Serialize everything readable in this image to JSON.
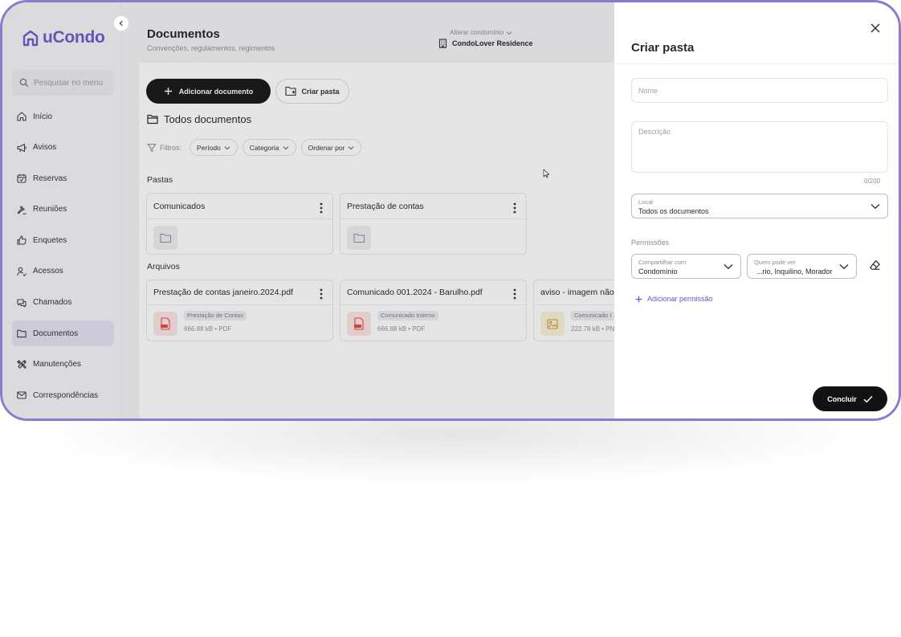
{
  "app": {
    "brand": "uCondo"
  },
  "sidebar": {
    "search_placeholder": "Pesquisar no menu",
    "items": [
      {
        "label": "Início",
        "icon": "home-icon"
      },
      {
        "label": "Avisos",
        "icon": "megaphone-icon"
      },
      {
        "label": "Reservas",
        "icon": "calendar-icon"
      },
      {
        "label": "Reuniões",
        "icon": "gavel-icon"
      },
      {
        "label": "Enquetes",
        "icon": "thumbs-up-icon"
      },
      {
        "label": "Acessos",
        "icon": "user-check-icon"
      },
      {
        "label": "Chamados",
        "icon": "chat-icon"
      },
      {
        "label": "Documentos",
        "icon": "folder-icon",
        "active": true
      },
      {
        "label": "Manutenções",
        "icon": "tools-icon"
      },
      {
        "label": "Correspondências",
        "icon": "mail-icon"
      }
    ]
  },
  "header": {
    "title": "Documentos",
    "subtitle": "Convenções, regulamentos, regimentos",
    "condo_caption": "Alterar condomínio",
    "condo_name": "CondoLover Residence"
  },
  "toolbar": {
    "add_document": "Adicionar documento",
    "create_folder": "Criar pasta"
  },
  "content": {
    "section_title": "Todos documentos",
    "filters_label": "Filtros:",
    "filters": [
      "Período",
      "Categoria",
      "Ordenar por"
    ],
    "folders_label": "Pastas",
    "folders": [
      {
        "name": "Comunicados"
      },
      {
        "name": "Prestação de contas"
      }
    ],
    "files_label": "Arquivos",
    "files": [
      {
        "name": "Prestação de contas janeiro.2024.pdf",
        "tag": "Prestação de Contas",
        "meta": "666.88 kB • PDF",
        "kind": "pdf"
      },
      {
        "name": "Comunicado 001.2024 - Barulho.pdf",
        "tag": "Comunicado Interno",
        "meta": "666.88 kB • PDF",
        "kind": "pdf"
      },
      {
        "name": "aviso - imagem não t",
        "tag": "Comunicado I",
        "meta": "222.78 kB • PN",
        "kind": "img"
      }
    ]
  },
  "drawer": {
    "title": "Criar pasta",
    "name_placeholder": "Nome",
    "description_placeholder": "Descrição",
    "counter": "0/200",
    "location_caption": "Local",
    "location_value": "Todos os documentos",
    "permissions_label": "Permissões",
    "share_caption": "Compartilhar com",
    "share_value": "Condomínio",
    "who_caption": "Quem pode ver",
    "who_value": "...rio, Inquilino, Morador",
    "add_permission": "Adicionar permissão",
    "done": "Concluir"
  },
  "colors": {
    "accent": "#6b55c9",
    "frame": "#8e79cf",
    "dark_button": "#121214"
  }
}
